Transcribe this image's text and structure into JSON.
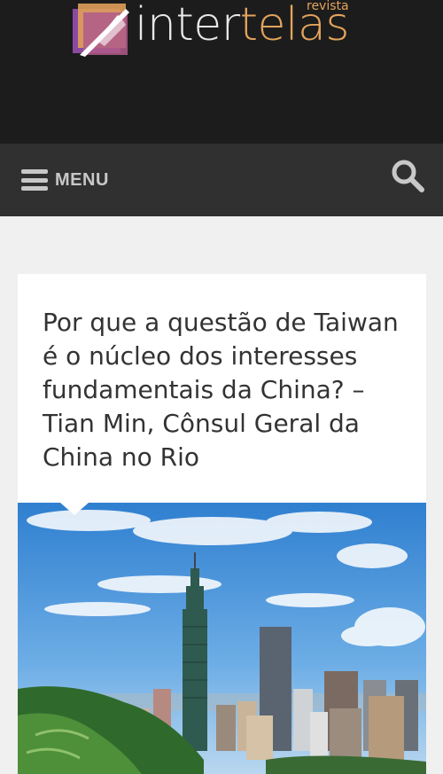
{
  "site": {
    "logo_main_prefix": "inter",
    "logo_main_accent": "telas",
    "logo_sub": "revista",
    "logo_icon": "quill-pen-logo-icon"
  },
  "nav": {
    "menu_label": "MENU",
    "menu_icon": "hamburger-icon",
    "search_icon": "search-icon"
  },
  "article": {
    "title": "Por que a questão de Taiwan é o núcleo dos interesses fundamentais da China? – Tian Min, Cônsul Geral da China no Rio"
  },
  "colors": {
    "header_bg": "#1c1c1c",
    "nav_bg": "#303030",
    "accent": "#e3a35c",
    "page_bg": "#f0f0f0"
  }
}
